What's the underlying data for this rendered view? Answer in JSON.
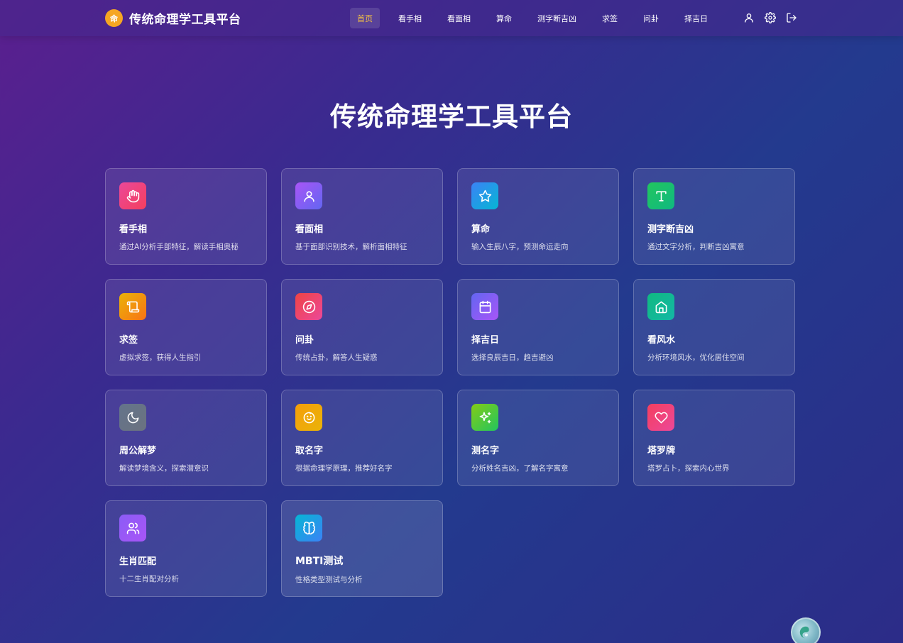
{
  "brand": {
    "logo_text": "命",
    "title": "传统命理学工具平台"
  },
  "nav": {
    "items": [
      {
        "label": "首页",
        "active": true
      },
      {
        "label": "看手相",
        "active": false
      },
      {
        "label": "看面相",
        "active": false
      },
      {
        "label": "算命",
        "active": false
      },
      {
        "label": "测字断吉凶",
        "active": false
      },
      {
        "label": "求签",
        "active": false
      },
      {
        "label": "问卦",
        "active": false
      },
      {
        "label": "择吉日",
        "active": false
      }
    ],
    "icons": [
      "user-icon",
      "gear-icon",
      "logout-icon"
    ]
  },
  "hero": {
    "title": "传统命理学工具平台"
  },
  "cards": [
    {
      "title": "看手相",
      "desc": "通过AI分析手部特征，解读手相奥秘",
      "icon": "hand-icon",
      "color_from": "#ec4899",
      "color_to": "#f43f5e"
    },
    {
      "title": "看面相",
      "desc": "基于面部识别技术，解析面相特征",
      "icon": "user-icon",
      "color_from": "#a855f7",
      "color_to": "#6366f1"
    },
    {
      "title": "算命",
      "desc": "输入生辰八字，预测命运走向",
      "icon": "star-icon",
      "color_from": "#3b82f6",
      "color_to": "#06b6d4"
    },
    {
      "title": "测字断吉凶",
      "desc": "通过文字分析，判断吉凶寓意",
      "icon": "type-icon",
      "color_from": "#22c55e",
      "color_to": "#10b981"
    },
    {
      "title": "求签",
      "desc": "虚拟求签，获得人生指引",
      "icon": "scroll-icon",
      "color_from": "#eab308",
      "color_to": "#f97316"
    },
    {
      "title": "问卦",
      "desc": "传统占卦，解答人生疑惑",
      "icon": "compass-icon",
      "color_from": "#ef4444",
      "color_to": "#ec4899"
    },
    {
      "title": "择吉日",
      "desc": "选择良辰吉日，趋吉避凶",
      "icon": "calendar-icon",
      "color_from": "#6366f1",
      "color_to": "#a855f7"
    },
    {
      "title": "看风水",
      "desc": "分析环境风水，优化居住空间",
      "icon": "home-icon",
      "color_from": "#10b981",
      "color_to": "#14b8a6"
    },
    {
      "title": "周公解梦",
      "desc": "解读梦境含义，探索潜意识",
      "icon": "moon-icon",
      "color_from": "#64748b",
      "color_to": "#6b7280"
    },
    {
      "title": "取名字",
      "desc": "根据命理学原理，推荐好名字",
      "icon": "baby-icon",
      "color_from": "#f59e0b",
      "color_to": "#eab308"
    },
    {
      "title": "测名字",
      "desc": "分析姓名吉凶，了解名字寓意",
      "icon": "sparkles-icon",
      "color_from": "#84cc16",
      "color_to": "#22c55e"
    },
    {
      "title": "塔罗牌",
      "desc": "塔罗占卜，探索内心世界",
      "icon": "heart-icon",
      "color_from": "#f43f5e",
      "color_to": "#ec4899"
    },
    {
      "title": "生肖匹配",
      "desc": "十二生肖配对分析",
      "icon": "users-icon",
      "color_from": "#8b5cf6",
      "color_to": "#a855f7"
    },
    {
      "title": "MBTI测试",
      "desc": "性格类型测试与分析",
      "icon": "brain-icon",
      "color_from": "#06b6d4",
      "color_to": "#3b82f6"
    }
  ],
  "float_button": {
    "icon": "assistant-orb-icon"
  }
}
